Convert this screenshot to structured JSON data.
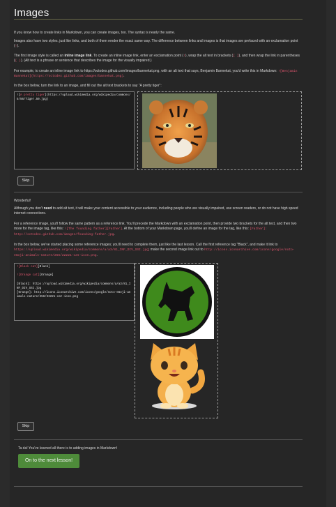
{
  "title": "Images",
  "section1": {
    "p1": "If you know how to create links in Markdown, you can create images, too. The syntax is nearly the same.",
    "p2a": "Images also have two styles, just like links, and both of them render the exact same way. The difference between links and images is that images are prefaced with an exclamation point (",
    "p2_code": "!",
    "p2b": ").",
    "p3a": "The first image style is called an ",
    "p3_bold": "inline image link",
    "p3b": ". To create an inline image link, enter an exclamation point (",
    "p3_code1": "!",
    "p3c": "), wrap the alt text in brackets (",
    "p3_code2": "[ ]",
    "p3d": "), and then wrap the link in parentheses (",
    "p3_code3": "( )",
    "p3e": "). (Alt text is a phrase or sentence that describes the image for the visually impaired.)",
    "p4a": "For example, to create an inline image link to https://octodex.github.com/images/bannekat.png, with an alt text that says, Benjamin Bannekat, you'd write this in Markdown: ",
    "p4_code": "![Benjamin Bannekat](https://octodex.github.com/images/bannekat.png)",
    "p4b": ".",
    "p5": "In the box below, turn the link to an image, and fill out the alt text brackets to say \"A pretty tiger\":",
    "editor_alt": "A pretty tiger",
    "editor_rest": "](https://upload.wikimedia.org/wikipedia/commons/5/56/Tiger.50.jpg)",
    "skip_label": "Skip"
  },
  "section2": {
    "wonderful": "Wonderful!",
    "p1a": "Although you don't ",
    "p1_bold": "need",
    "p1b": " to add alt text, it will make your content accessible to your audience, including people who are visually impaired, use screen readers, or do not have high speed internet connections.",
    "p2a": "For a reference image, you'll follow the same pattern as a reference link. You'll precede the Markdown with an exclamation point, then provide two brackets for the alt text, and then two more for the image tag, like this: ",
    "p2_code1": "![The founding father][Father]",
    "p2b": ". At the bottom of your Markdown page, you'll define an image for the tag, like this: ",
    "p2_code2": "[Father]: http://octodex.github.com/images/founding-father.jpg",
    "p2c": ".",
    "p3a": "In the box below, we've started placing some reference images; you'll need to complete them, just like the last lesson. Call the first reference tag \"Black\", and make it link to ",
    "p3_code1": "https://upload.wikimedia.org/wikipedia/commons/a/a3/81_INF_DIV_SSI.jpg",
    "p3b": "; make the second image link out to ",
    "p3_code2": "http://icons.iconarchive.com/icons/google/noto-emoji-animals-nature/256/22221-cat-icon.png",
    "p3c": ".",
    "editor_line1_red": "![Black cat]",
    "editor_line1_rest": "[Black]",
    "editor_line2_red": "![Orange cat]",
    "editor_line2_rest": "[Orange]",
    "editor_def1": "[Black]: https://upload.wikimedia.org/wikipedia/commons/a/a3/81_INF_DIV_SSI.jpg",
    "editor_def2": "[Orange]: http://icons.iconarchive.com/icons/google/noto-emoji-animals-nature/256/22221-cat-icon.png",
    "skip_label": "Skip"
  },
  "finish": {
    "text": "Ta da! You've learned all there is to adding images in Markdown!",
    "next_label": "On to the next lesson!"
  },
  "colors": {
    "background": "#262626",
    "code": "#e0566e",
    "next_button": "#4e8b3a",
    "heading_rule": "#6b6b4a"
  }
}
